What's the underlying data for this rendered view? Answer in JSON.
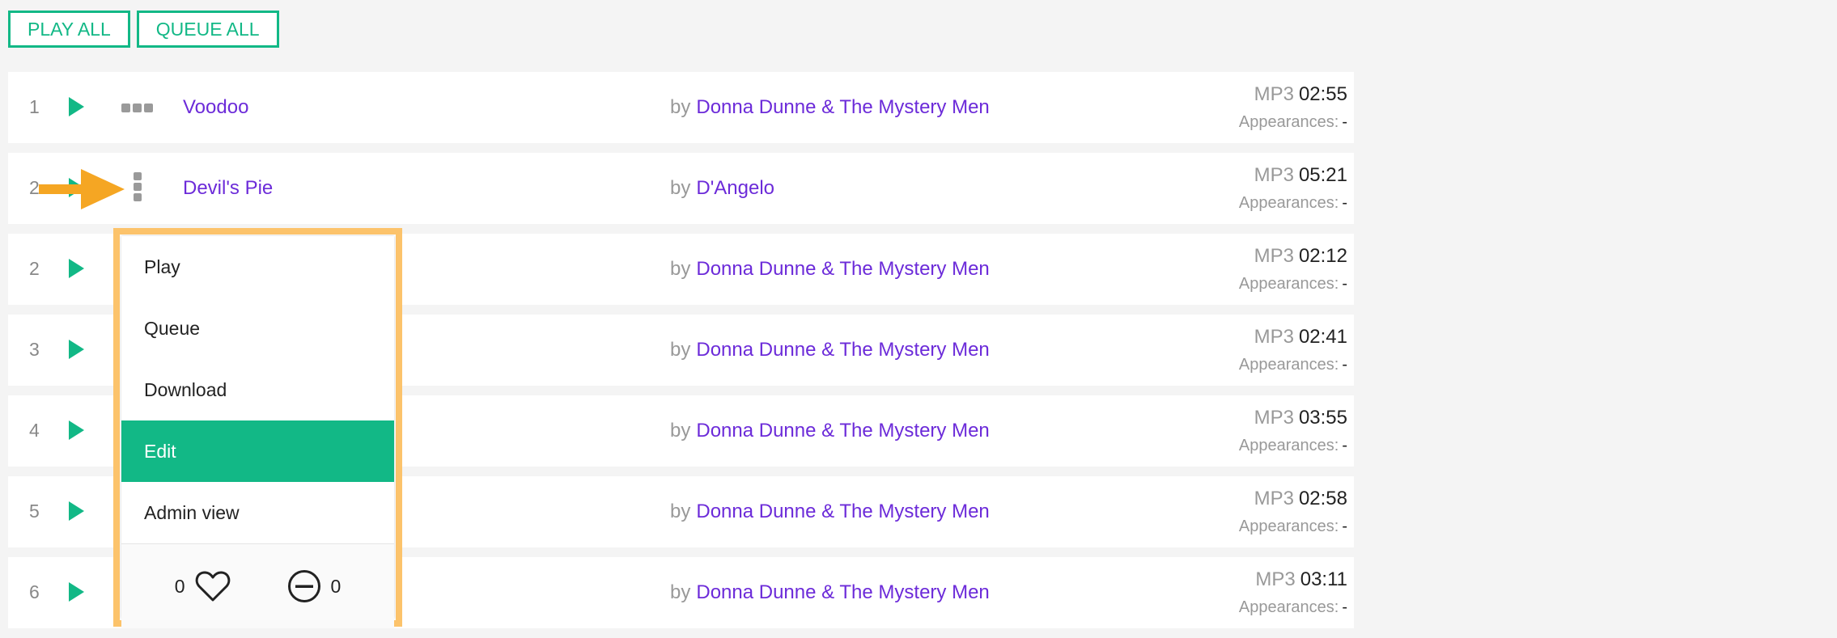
{
  "actions": {
    "play_all": "PLAY ALL",
    "queue_all": "QUEUE ALL"
  },
  "tracks": [
    {
      "num": "1",
      "title": "Voodoo",
      "by": "by",
      "artist": "Donna Dunne & The Mystery Men",
      "format": "MP3",
      "duration": "02:55",
      "appearances_label": "Appearances:",
      "appearances": "-"
    },
    {
      "num": "2",
      "title": "Devil's Pie",
      "by": "by",
      "artist": "D'Angelo",
      "format": "MP3",
      "duration": "05:21",
      "appearances_label": "Appearances:",
      "appearances": "-"
    },
    {
      "num": "2",
      "title": "",
      "by": "by",
      "artist": "Donna Dunne & The Mystery Men",
      "format": "MP3",
      "duration": "02:12",
      "appearances_label": "Appearances:",
      "appearances": "-"
    },
    {
      "num": "3",
      "title": "",
      "by": "by",
      "artist": "Donna Dunne & The Mystery Men",
      "format": "MP3",
      "duration": "02:41",
      "appearances_label": "Appearances:",
      "appearances": "-"
    },
    {
      "num": "4",
      "title": "",
      "by": "by",
      "artist": "Donna Dunne & The Mystery Men",
      "format": "MP3",
      "duration": "03:55",
      "appearances_label": "Appearances:",
      "appearances": "-"
    },
    {
      "num": "5",
      "title": "",
      "by": "by",
      "artist": "Donna Dunne & The Mystery Men",
      "format": "MP3",
      "duration": "02:58",
      "appearances_label": "Appearances:",
      "appearances": "-"
    },
    {
      "num": "6",
      "title": "",
      "by": "by",
      "artist": "Donna Dunne & The Mystery Men",
      "format": "MP3",
      "duration": "03:11",
      "appearances_label": "Appearances:",
      "appearances": "-"
    }
  ],
  "context_menu": {
    "items": [
      "Play",
      "Queue",
      "Download",
      "Edit",
      "Admin view"
    ],
    "active_item": "Edit",
    "likes": "0",
    "dislikes": "0"
  },
  "colors": {
    "accent": "#12b886",
    "link": "#6c2bd9",
    "highlight_border": "#fcc36b",
    "arrow": "#f5a623"
  },
  "icons": {
    "play": "play-icon",
    "more_horizontal": "more-horizontal-icon",
    "more_vertical": "more-vertical-icon",
    "heart": "heart-icon",
    "minus_circle": "minus-circle-icon",
    "annotation_arrow": "arrow-right-icon"
  }
}
